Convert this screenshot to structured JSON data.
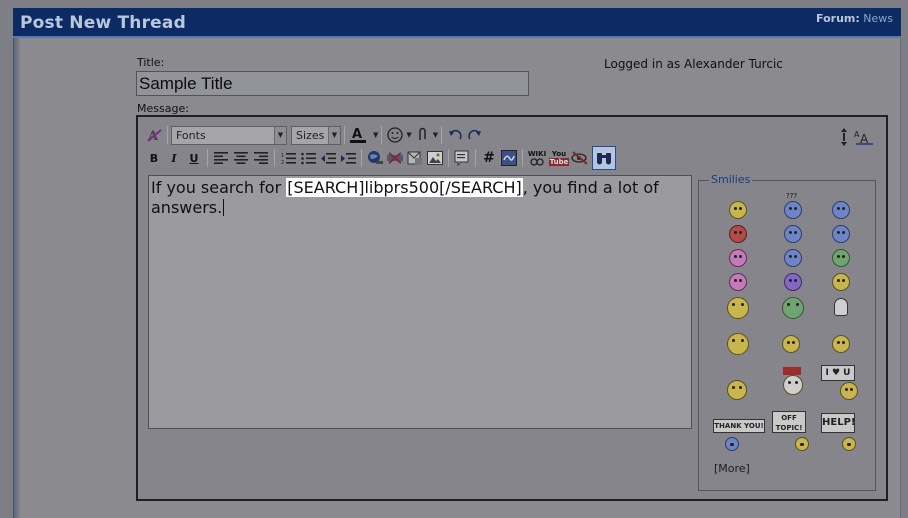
{
  "header": {
    "title": "Post New Thread",
    "forum_label": "Forum:",
    "forum_name": "News"
  },
  "form": {
    "title_label": "Title:",
    "title_value": "Sample Title",
    "logged_in": "Logged in as Alexander Turcic",
    "message_label": "Message:"
  },
  "toolbar": {
    "font_combo": "Fonts",
    "size_combo": "Sizes",
    "wiki": "WIKI",
    "youtube_top": "You",
    "youtube_bottom": "Tube",
    "hash": "#"
  },
  "message": {
    "before": "If you search for ",
    "highlight": "[SEARCH]libprs500[/SEARCH]",
    "after": ", you find a lot of answers."
  },
  "smilies": {
    "legend": "Smilies",
    "more": "[More]",
    "questionmarks": "???",
    "sign_love": "I ♥ U",
    "sign_thanks": "THANK YOU!",
    "sign_offtopic": "OFF TOPIC!",
    "sign_help": "HELP!"
  }
}
